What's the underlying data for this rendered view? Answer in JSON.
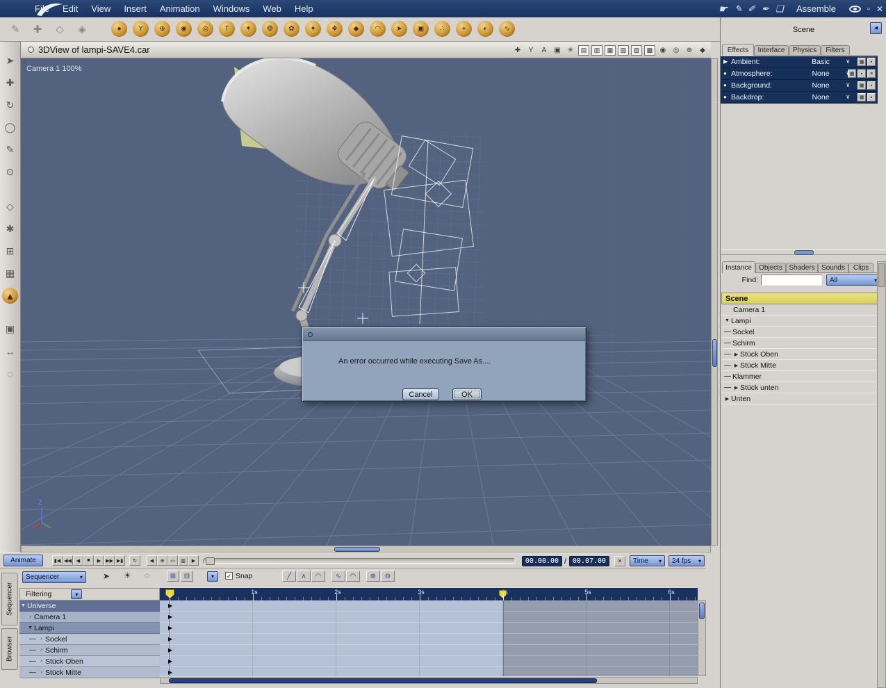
{
  "colors": {
    "accent_blue": "#7695d6",
    "viewport_bg": "#53627e",
    "ruler_navy": "#18315e",
    "timeline_light": "#b5c1d6",
    "timeline_dark": "#959daf",
    "marker_yellow": "#e8d84a"
  },
  "menubar": {
    "items": [
      "File",
      "Edit",
      "View",
      "Insert",
      "Animation",
      "Windows",
      "Web",
      "Help"
    ],
    "mode_label": "Assemble",
    "hand_glyph": "☛",
    "tool_glyphs": [
      "✎",
      "✐",
      "✒",
      "❏"
    ],
    "minimize_glyph": "▫",
    "close_glyph": "✕"
  },
  "toolbar": {
    "left_tools": [
      {
        "name": "knife-tool-icon",
        "glyph": "✎"
      },
      {
        "name": "hand-tool-icon",
        "glyph": "✚"
      },
      {
        "name": "shape-tool-icon",
        "glyph": "◇"
      },
      {
        "name": "drop-tool-icon",
        "glyph": "◈"
      }
    ],
    "insert_icons": [
      {
        "name": "insert-sphere-icon",
        "glyph": "●"
      },
      {
        "name": "insert-vertex-object-icon",
        "glyph": "Y"
      },
      {
        "name": "insert-spline-object-icon",
        "glyph": "⊕"
      },
      {
        "name": "insert-metaball-icon",
        "glyph": "◉"
      },
      {
        "name": "insert-ring-icon",
        "glyph": "◎"
      },
      {
        "name": "insert-text-icon",
        "glyph": "T"
      },
      {
        "name": "insert-particles-icon",
        "glyph": "✶"
      },
      {
        "name": "insert-star-icon",
        "glyph": "❂"
      },
      {
        "name": "insert-plant-icon",
        "glyph": "✿"
      },
      {
        "name": "insert-sparkle-icon",
        "glyph": "✦"
      },
      {
        "name": "insert-shell-icon",
        "glyph": "❖"
      },
      {
        "name": "insert-rock-icon",
        "glyph": "◆"
      },
      {
        "name": "insert-terrain-icon",
        "glyph": "◠"
      },
      {
        "name": "insert-arrow-icon",
        "glyph": "➤"
      },
      {
        "name": "insert-camera-icon",
        "glyph": "▣"
      },
      {
        "name": "insert-swarm-icon",
        "glyph": "∴"
      },
      {
        "name": "insert-target-icon",
        "glyph": "⌖"
      },
      {
        "name": "insert-light-icon",
        "glyph": "◐"
      },
      {
        "name": "insert-bone-icon",
        "glyph": "∿"
      }
    ]
  },
  "tool_palette": {
    "items": [
      {
        "name": "select-tool",
        "glyph": "➤"
      },
      {
        "name": "move-tool",
        "glyph": "✚"
      },
      {
        "name": "rotate-tool",
        "glyph": "↻"
      },
      {
        "name": "scale-tool",
        "glyph": "◯"
      },
      {
        "name": "eyedropper-tool",
        "glyph": "✎"
      },
      {
        "name": "link-tool",
        "glyph": "⊙"
      },
      {
        "name": "shape-tool",
        "glyph": "◇"
      },
      {
        "name": "spray-tool",
        "glyph": "✱"
      },
      {
        "name": "grid-tool",
        "glyph": "⊞"
      },
      {
        "name": "mesh-tool",
        "glyph": "▦"
      },
      {
        "name": "texture-ball-tool",
        "glyph": "▲"
      },
      {
        "name": "camera-dolly-tool",
        "glyph": "▣"
      },
      {
        "name": "pan-tool",
        "glyph": "↔"
      },
      {
        "name": "zoom-tool",
        "glyph": "◌"
      }
    ]
  },
  "viewport": {
    "title": "3DView of lampi-SAVE4.car",
    "camera_label": "Camera 1 100%",
    "axis_label": "Z",
    "header_icons": [
      {
        "name": "pose-icon",
        "glyph": "✚"
      },
      {
        "name": "bone-display-icon",
        "glyph": "Y"
      },
      {
        "name": "annotation-icon",
        "glyph": "A"
      },
      {
        "name": "camera-icon",
        "glyph": "▣"
      },
      {
        "name": "snap-icon",
        "glyph": "✳"
      },
      {
        "name": "wireframe-mode-icon",
        "glyph": "▤"
      },
      {
        "name": "lit-wire-mode-icon",
        "glyph": "▥"
      },
      {
        "name": "flat-mode-icon",
        "glyph": "▦"
      },
      {
        "name": "gouraud-mode-icon",
        "glyph": "▧"
      },
      {
        "name": "phong-mode-icon",
        "glyph": "▨"
      },
      {
        "name": "textured-mode-icon",
        "glyph": "▩"
      },
      {
        "name": "preview-sphere-icon",
        "glyph": "◉"
      },
      {
        "name": "preview-globe-icon",
        "glyph": "◎"
      },
      {
        "name": "orbit-view-icon",
        "glyph": "⊕"
      },
      {
        "name": "cube-view-icon",
        "glyph": "◆"
      }
    ]
  },
  "dialog": {
    "message": "An error occurred while executing Save As....",
    "cancel_label": "Cancel",
    "ok_label": "OK"
  },
  "right_top": {
    "title": "Scene",
    "back_glyph": "◂",
    "tabs": [
      "Effects",
      "Interface",
      "Physics",
      "Filters"
    ],
    "chevron": "∨",
    "rows": [
      {
        "marker": "▶",
        "label": "Ambient:",
        "value": "Basic",
        "buttons": [
          "▦",
          "▪"
        ]
      },
      {
        "marker": "●",
        "label": "Atmosphere:",
        "value": "None",
        "buttons": [
          "▦",
          "▪",
          "≡"
        ]
      },
      {
        "marker": "●",
        "label": "Background:",
        "value": "None",
        "buttons": [
          "▦",
          "▪"
        ]
      },
      {
        "marker": "●",
        "label": "Backdrop:",
        "value": "None",
        "buttons": [
          "▦",
          "▪"
        ]
      }
    ]
  },
  "right_bottom": {
    "tabs": [
      "Instance",
      "Objects",
      "Shaders",
      "Sounds",
      "Clips"
    ],
    "find_label": "Find:",
    "filter_value": "All",
    "dd_chevron": "▾",
    "scene_header": "Scene",
    "tree": [
      {
        "arrow": "",
        "label": "Camera 1"
      },
      {
        "arrow": "▼",
        "label": "Lampi"
      },
      {
        "arrow": "",
        "label": "Sockel"
      },
      {
        "arrow": "",
        "label": "Schirm"
      },
      {
        "arrow": "▶",
        "label": "Stück Oben"
      },
      {
        "arrow": "▶",
        "label": "Stück Mitte"
      },
      {
        "arrow": "",
        "label": "Klammer"
      },
      {
        "arrow": "▶",
        "label": "Stück unten"
      },
      {
        "arrow": "▶",
        "label": "Unten"
      }
    ]
  },
  "transport": {
    "animate_label": "Animate",
    "vcr": [
      "▮◀",
      "◀◀",
      "◀",
      "■",
      "▶",
      "▶▶",
      "▶▮"
    ],
    "loop_glyph": "↻",
    "key_buttons": [
      "◀",
      "⊕",
      "▭",
      "▥",
      "▶"
    ],
    "current_time": "00.00.00",
    "time_separator": "/",
    "end_time": "00.07.00",
    "clear_glyph": "✕",
    "time_mode": "Time",
    "fps": "24 fps",
    "dd_chevron": "▾"
  },
  "sequencer": {
    "side_tabs": [
      "Sequencer",
      "Browser"
    ],
    "dropdown_label": "Sequencer",
    "pointer_glyph": "➤",
    "sun_glyph": "☀",
    "zoom_glyph": "◌",
    "toggle_glyphs": [
      "⊞",
      "⊟"
    ],
    "mini_dd_glyph": "▾",
    "snap_check": "✓",
    "snap_label": "Snap",
    "curve_a": [
      "╱",
      "∧",
      "◠"
    ],
    "curve_b": [
      "∿",
      "◠"
    ],
    "curve_c": [
      "⊕",
      "⊖"
    ],
    "filtering_label": "Filtering",
    "tree": [
      {
        "arrow": "▼",
        "label": "Universe"
      },
      {
        "arrow": "›",
        "label": "Camera 1"
      },
      {
        "arrow": "▼",
        "label": "Lampi"
      },
      {
        "arrow": "›",
        "label": "Sockel"
      },
      {
        "arrow": "›",
        "label": "Schirm"
      },
      {
        "arrow": "›",
        "label": "Stück Oben"
      },
      {
        "arrow": "›",
        "label": "Stück Mitte"
      }
    ],
    "ruler_labels": [
      "1s",
      "2s",
      "3s",
      "4s",
      "5s",
      "6s"
    ]
  }
}
